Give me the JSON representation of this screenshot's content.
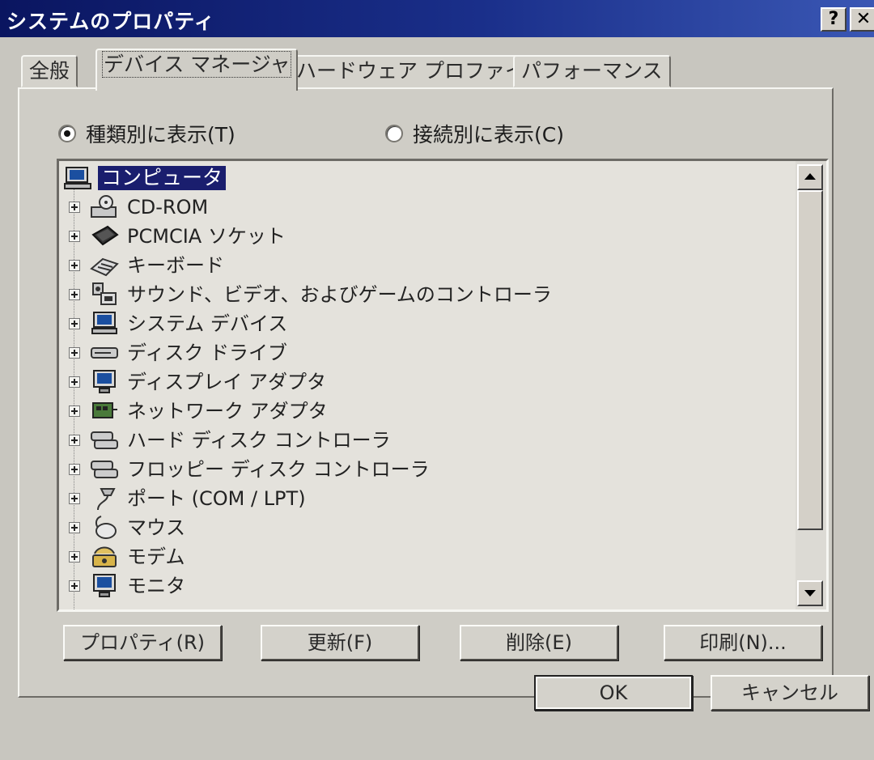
{
  "window": {
    "title": "システムのプロパティ",
    "help_glyph": "?",
    "close_glyph": "✕"
  },
  "tabs": [
    {
      "label": "全般",
      "active": false
    },
    {
      "label": "デバイス マネージャ",
      "active": true
    },
    {
      "label": "ハードウェア プロファイル",
      "active": false
    },
    {
      "label": "パフォーマンス",
      "active": false
    }
  ],
  "view_options": {
    "by_type": {
      "label": "種類別に表示(T)",
      "checked": true
    },
    "by_connection": {
      "label": "接続別に表示(C)",
      "checked": false
    }
  },
  "tree": {
    "root": {
      "label": "コンピュータ",
      "icon": "computer-icon"
    },
    "items": [
      {
        "label": "CD-ROM",
        "icon": "cdrom-icon"
      },
      {
        "label": "PCMCIA ソケット",
        "icon": "pcmcia-icon"
      },
      {
        "label": "キーボード",
        "icon": "keyboard-icon"
      },
      {
        "label": "サウンド、ビデオ、およびゲームのコントローラ",
        "icon": "sound-video-game-icon"
      },
      {
        "label": "システム デバイス",
        "icon": "system-device-icon"
      },
      {
        "label": "ディスク ドライブ",
        "icon": "disk-drive-icon"
      },
      {
        "label": "ディスプレイ アダプタ",
        "icon": "display-adapter-icon"
      },
      {
        "label": "ネットワーク アダプタ",
        "icon": "network-adapter-icon"
      },
      {
        "label": "ハード ディスク コントローラ",
        "icon": "hard-disk-controller-icon"
      },
      {
        "label": "フロッピー ディスク コントローラ",
        "icon": "floppy-controller-icon"
      },
      {
        "label": "ポート (COM / LPT)",
        "icon": "port-icon"
      },
      {
        "label": "マウス",
        "icon": "mouse-icon"
      },
      {
        "label": "モデム",
        "icon": "modem-icon"
      },
      {
        "label": "モニタ",
        "icon": "monitor-icon"
      }
    ]
  },
  "panel_buttons": {
    "properties": "プロパティ(R)",
    "refresh": "更新(F)",
    "remove": "削除(E)",
    "print": "印刷(N)..."
  },
  "dialog_buttons": {
    "ok": "OK",
    "cancel": "キャンセル"
  },
  "colors": {
    "titlebar": "#0a1560",
    "face": "#d4d0c8",
    "selection": "#1a1e6e"
  }
}
